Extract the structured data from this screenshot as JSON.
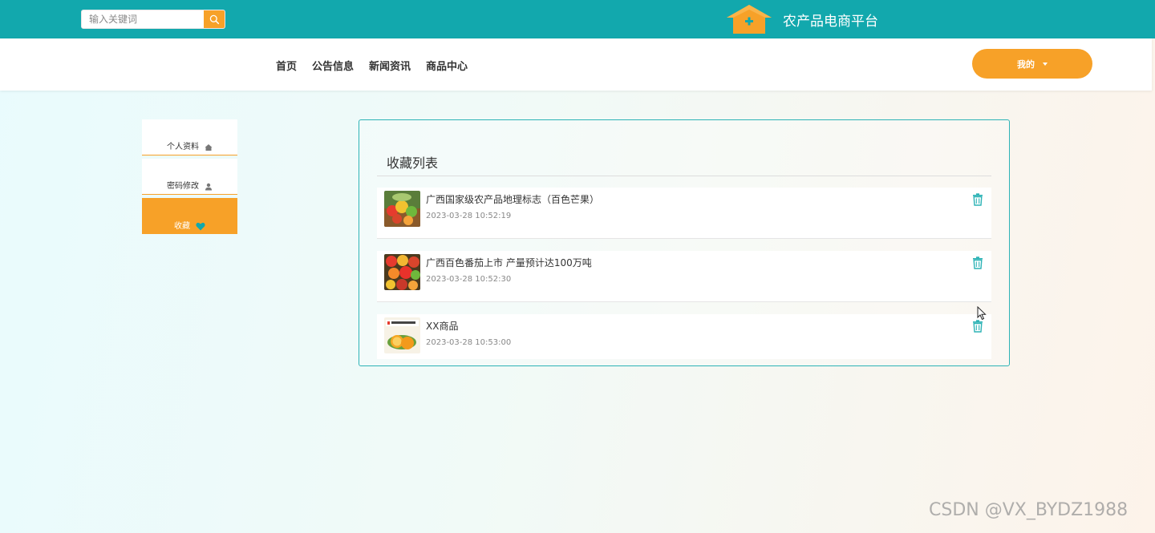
{
  "header": {
    "search_placeholder": "输入关键词",
    "site_title": "农产品电商平台"
  },
  "nav": {
    "items": [
      "首页",
      "公告信息",
      "新闻资讯",
      "商品中心"
    ],
    "my_label": "我的"
  },
  "sidebar": {
    "items": [
      {
        "label": "个人资料",
        "icon": "home-icon"
      },
      {
        "label": "密码修改",
        "icon": "user-icon"
      },
      {
        "label": "收藏",
        "icon": "heart-icon",
        "active": true
      }
    ]
  },
  "favorites": {
    "title": "收藏列表",
    "items": [
      {
        "name": "广西国家级农产品地理标志（百色芒果）",
        "time": "2023-03-28 10:52:19",
        "thumb": "fruit-basket"
      },
      {
        "name": "广西百色番茄上市 产量预计达100万吨",
        "time": "2023-03-28 10:52:30",
        "thumb": "vegetables"
      },
      {
        "name": "XX商品",
        "time": "2023-03-28 10:53:00",
        "thumb": "orange"
      }
    ]
  },
  "watermark": "CSDN @VX_BYDZ1988",
  "colors": {
    "teal": "#12a8ad",
    "orange": "#f7a128",
    "border": "#2db3b6"
  }
}
